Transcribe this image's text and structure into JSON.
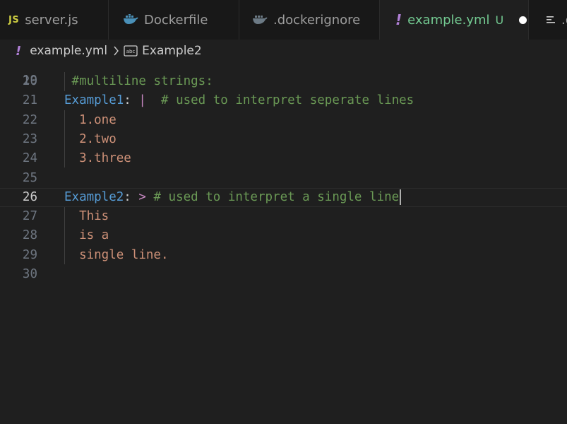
{
  "tabs": [
    {
      "icon": "javascript-file-icon",
      "icon_text": "JS",
      "label": "server.js"
    },
    {
      "icon": "docker-whale-icon",
      "label": "Dockerfile"
    },
    {
      "icon": "docker-whale-icon",
      "label": ".dockerignore"
    },
    {
      "icon": "yaml-file-icon",
      "icon_text": "!",
      "label": "example.yml",
      "status": "U"
    },
    {
      "icon": "lines-file-icon",
      "label": ".g"
    }
  ],
  "breadcrumbs": {
    "file_icon_text": "!",
    "file": "example.yml",
    "symbol_icon": "abc-string-symbol-icon",
    "symbol": "Example2"
  },
  "editor": {
    "partial_top_line_number": "19",
    "lines": [
      {
        "n": "20",
        "indent": " ",
        "parts": [
          {
            "t": "#multiline strings:",
            "c": "comment"
          }
        ]
      },
      {
        "n": "21",
        "parts": [
          {
            "t": "Example1",
            "c": "key"
          },
          {
            "t": ": ",
            "c": "punct"
          },
          {
            "t": "|",
            "c": "pipe"
          },
          {
            "t": "  # used to interpret seperate lines",
            "c": "comment"
          }
        ]
      },
      {
        "n": "22",
        "indent": "  ",
        "parts": [
          {
            "t": "1.one",
            "c": "str"
          }
        ]
      },
      {
        "n": "23",
        "indent": "  ",
        "parts": [
          {
            "t": "2.two",
            "c": "str"
          }
        ]
      },
      {
        "n": "24",
        "indent": "  ",
        "parts": [
          {
            "t": "3.three",
            "c": "str"
          }
        ]
      },
      {
        "n": "25",
        "parts": []
      },
      {
        "n": "26",
        "current": true,
        "parts": [
          {
            "t": "Example2",
            "c": "key"
          },
          {
            "t": ": ",
            "c": "punct"
          },
          {
            "t": ">",
            "c": "pipe"
          },
          {
            "t": " # used to interpret a single line",
            "c": "comment"
          }
        ]
      },
      {
        "n": "27",
        "indent": "  ",
        "parts": [
          {
            "t": "This",
            "c": "str"
          }
        ]
      },
      {
        "n": "28",
        "indent": "  ",
        "parts": [
          {
            "t": "is a",
            "c": "str"
          }
        ]
      },
      {
        "n": "29",
        "indent": "  ",
        "parts": [
          {
            "t": "single line.",
            "c": "str"
          }
        ]
      },
      {
        "n": "30",
        "parts": []
      }
    ]
  },
  "colors": {
    "background": "#1f1f1f",
    "tab_bar": "#181818",
    "key": "#569cd6",
    "comment": "#6a9955",
    "string": "#ce9178",
    "block_indicator": "#c586c0",
    "modified": "#73c991",
    "yaml_icon": "#b180d7",
    "js_icon": "#cbcb41",
    "docker_icon": "#4a90b8"
  }
}
